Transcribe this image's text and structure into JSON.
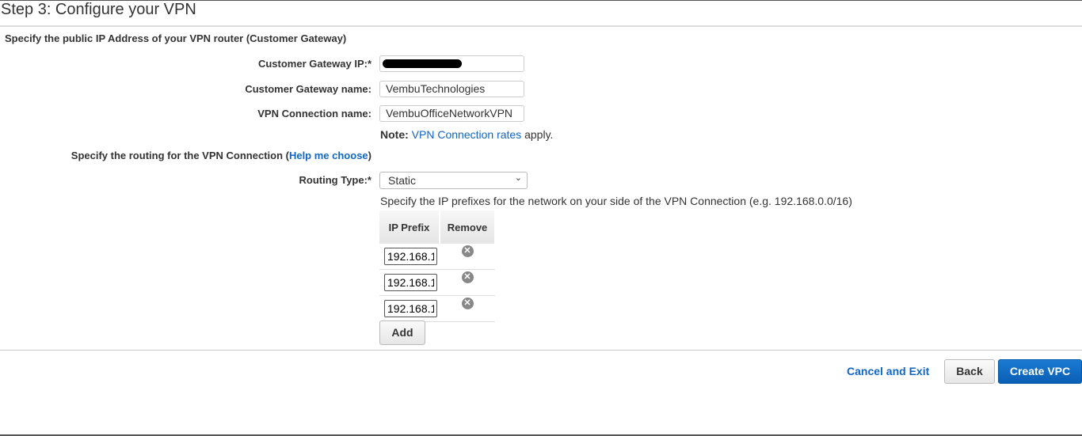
{
  "title": "Step 3: Configure your VPN",
  "gateway_section": "Specify the public IP Address of your VPN router (Customer Gateway)",
  "fields": {
    "cgw_ip_label": "Customer Gateway IP:*",
    "cgw_name_label": "Customer Gateway name:",
    "cgw_name_value": "VembuTechnologies",
    "vpn_name_label": "VPN Connection name:",
    "vpn_name_value": "VembuOfficeNetworkVPN"
  },
  "note": {
    "label": "Note:",
    "link": "VPN Connection rates",
    "suffix": "apply."
  },
  "routing": {
    "section_prefix": "Specify the routing for the VPN Connection (",
    "help_link": "Help me choose",
    "section_suffix": ")",
    "type_label": "Routing Type:*",
    "type_value": "Static",
    "prefix_hint": "Specify the IP prefixes for the network on your side of the VPN Connection (e.g. 192.168.0.0/16)"
  },
  "table": {
    "headers": [
      "IP Prefix",
      "Remove"
    ],
    "rows": [
      {
        "prefix": "192.168.1"
      },
      {
        "prefix": "192.168.1"
      },
      {
        "prefix": "192.168.1"
      }
    ],
    "add_label": "Add"
  },
  "footer": {
    "cancel": "Cancel and Exit",
    "back": "Back",
    "create": "Create VPC"
  },
  "colors": {
    "link": "#1266c4",
    "primary": "#0a6bc4"
  }
}
